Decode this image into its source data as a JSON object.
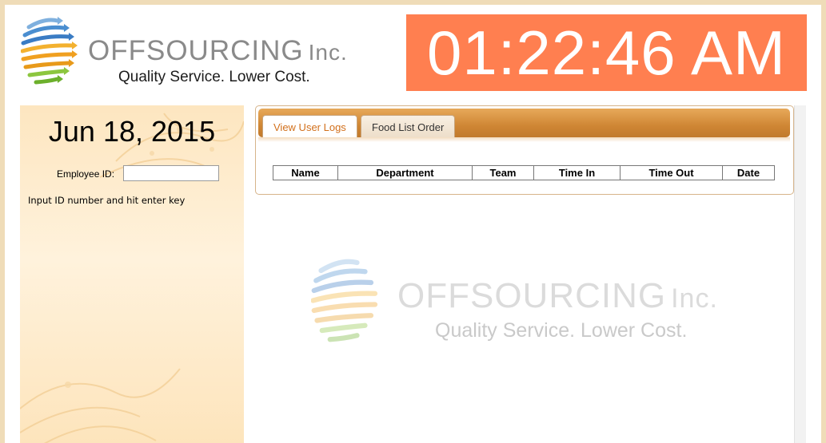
{
  "header": {
    "brand_name": "OFFSOURCING",
    "brand_suffix": "Inc.",
    "tagline": "Quality Service. Lower Cost.",
    "clock_time": "01:22:46 AM",
    "clock_color": "#ff7f50"
  },
  "left_panel": {
    "date": "Jun 18, 2015",
    "employee_id_label": "Employee ID:",
    "employee_id_value": "",
    "hint": "Input ID number and hit enter key"
  },
  "tabs": [
    {
      "label": "View User Logs",
      "active": true
    },
    {
      "label": "Food List Order",
      "active": false
    }
  ],
  "logs_table": {
    "columns": [
      "Name",
      "Department",
      "Team",
      "Time In",
      "Time Out",
      "Date"
    ],
    "rows": []
  },
  "colors": {
    "accent": "#ff7f50",
    "tab_bar": "#cf8634",
    "active_tab_text": "#d2701c",
    "panel_bg": "#fde6c0"
  }
}
